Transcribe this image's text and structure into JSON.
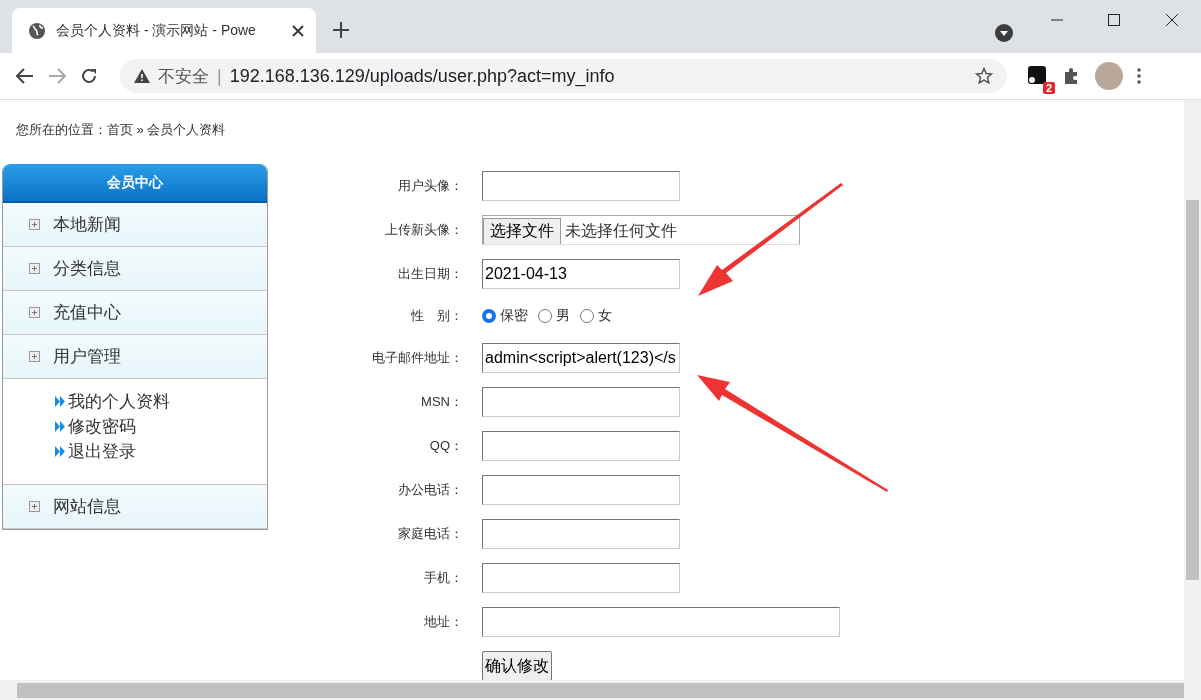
{
  "browser": {
    "tab_title": "会员个人资料 - 演示网站 - Powe",
    "security_label": "不安全",
    "separator": "|",
    "url": "192.168.136.129/uploads/user.php?act=my_info",
    "extension_badge": "2"
  },
  "breadcrumb": "您所在的位置：首页 » 会员个人资料",
  "sidebar": {
    "title": "会员中心",
    "sections": [
      {
        "label": "本地新闻"
      },
      {
        "label": "分类信息"
      },
      {
        "label": "充值中心"
      },
      {
        "label": "用户管理",
        "children": [
          {
            "label": "我的个人资料"
          },
          {
            "label": "修改密码"
          },
          {
            "label": "退出登录"
          }
        ]
      },
      {
        "label": "网站信息"
      }
    ]
  },
  "form": {
    "fields": [
      {
        "kind": "text",
        "label": "用户头像："
      },
      {
        "kind": "file",
        "label": "上传新头像：",
        "button": "选择文件",
        "status": "未选择任何文件"
      },
      {
        "kind": "text",
        "label": "出生日期：",
        "value": "2021-04-13"
      },
      {
        "kind": "radio",
        "label": "性　别：",
        "options": [
          {
            "label": "保密",
            "selected": true
          },
          {
            "label": "男",
            "selected": false
          },
          {
            "label": "女",
            "selected": false
          }
        ]
      },
      {
        "kind": "text",
        "label": "电子邮件地址：",
        "value": "admin<script>alert(123)</s"
      },
      {
        "kind": "text",
        "label": "MSN："
      },
      {
        "kind": "text",
        "label": "QQ："
      },
      {
        "kind": "text",
        "label": "办公电话："
      },
      {
        "kind": "text",
        "label": "家庭电话："
      },
      {
        "kind": "text",
        "label": "手机："
      },
      {
        "kind": "wide",
        "label": "地址："
      }
    ],
    "submit": "确认修改"
  }
}
